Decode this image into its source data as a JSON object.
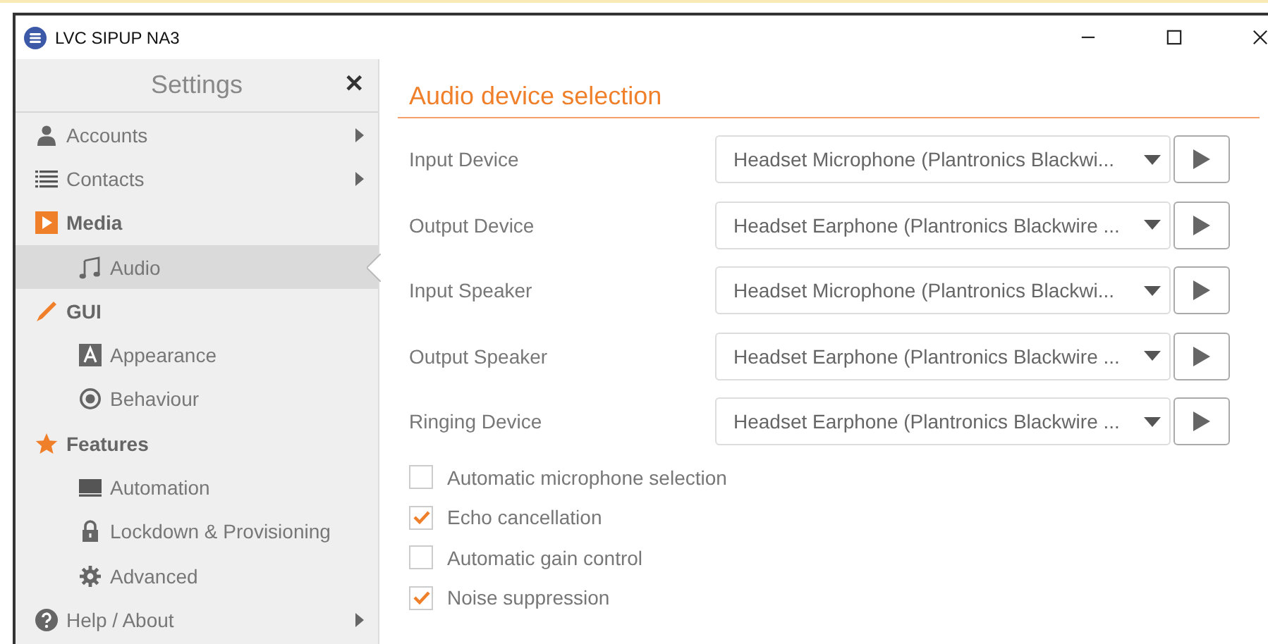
{
  "window": {
    "title": "LVC SIPUP NA3"
  },
  "sidebar": {
    "title": "Settings",
    "close": "✕",
    "items": [
      {
        "kind": "item",
        "label": "Accounts",
        "has_submenu": true,
        "selected": false
      },
      {
        "kind": "item",
        "label": "Contacts",
        "has_submenu": true,
        "selected": false
      },
      {
        "kind": "section",
        "label": "Media",
        "has_submenu": false,
        "selected": false
      },
      {
        "kind": "subitem",
        "label": "Audio",
        "has_submenu": false,
        "selected": true
      },
      {
        "kind": "section",
        "label": "GUI",
        "has_submenu": false,
        "selected": false
      },
      {
        "kind": "subitem",
        "label": "Appearance",
        "has_submenu": false,
        "selected": false
      },
      {
        "kind": "subitem",
        "label": "Behaviour",
        "has_submenu": false,
        "selected": false
      },
      {
        "kind": "section",
        "label": "Features",
        "has_submenu": false,
        "selected": false
      },
      {
        "kind": "subitem",
        "label": "Automation",
        "has_submenu": false,
        "selected": false
      },
      {
        "kind": "subitem",
        "label": "Lockdown & Provisioning",
        "has_submenu": false,
        "selected": false
      },
      {
        "kind": "subitem",
        "label": "Advanced",
        "has_submenu": false,
        "selected": false
      },
      {
        "kind": "item",
        "label": "Help / About",
        "has_submenu": true,
        "selected": false
      }
    ]
  },
  "content": {
    "title": "Audio device selection",
    "devices": [
      {
        "label": "Input Device",
        "value": "Headset Microphone (Plantronics Blackwi..."
      },
      {
        "label": "Output Device",
        "value": "Headset Earphone (Plantronics Blackwire ..."
      },
      {
        "label": "Input Speaker",
        "value": "Headset Microphone (Plantronics Blackwi..."
      },
      {
        "label": "Output Speaker",
        "value": "Headset Earphone (Plantronics Blackwire ..."
      },
      {
        "label": "Ringing Device",
        "value": "Headset Earphone (Plantronics Blackwire ..."
      }
    ],
    "options": [
      {
        "label": "Automatic microphone selection",
        "checked": false
      },
      {
        "label": "Echo cancellation",
        "checked": true
      },
      {
        "label": "Automatic gain control",
        "checked": false
      },
      {
        "label": "Noise suppression",
        "checked": true
      }
    ]
  }
}
